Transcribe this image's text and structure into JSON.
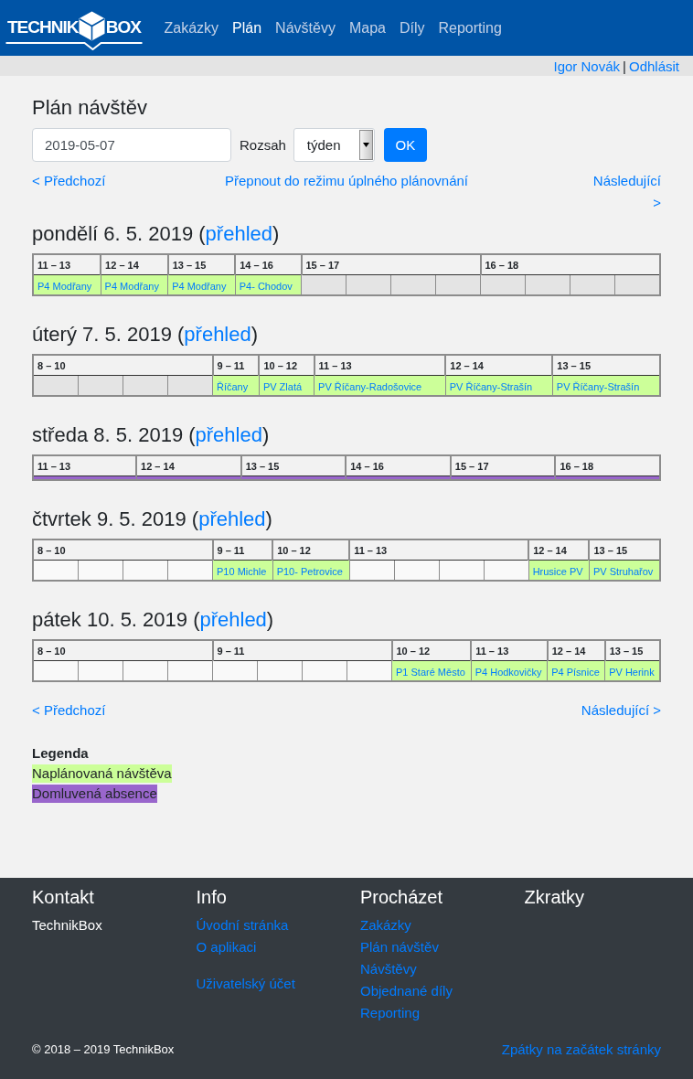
{
  "header": {
    "logo": {
      "left": "TECHNIK",
      "right": "BOX"
    },
    "nav": [
      {
        "label": "Zakázky",
        "selected": false
      },
      {
        "label": "Plán",
        "selected": true
      },
      {
        "label": "Návštěvy",
        "selected": false
      },
      {
        "label": "Mapa",
        "selected": false
      },
      {
        "label": "Díly",
        "selected": false
      },
      {
        "label": "Reporting",
        "selected": false
      }
    ]
  },
  "user_bar": {
    "user": "Igor Novák",
    "separator": "|",
    "logout": "Odhlásit"
  },
  "page_title": "Plán návštěv",
  "form": {
    "date": "2019-05-07",
    "range_label": "Rozsah",
    "range": "týden",
    "submit": "OK"
  },
  "pager_top": {
    "previous": "< Předchozí",
    "switch_mode": "Přepnout do režimu úplného plánovnání",
    "next": "Následující >"
  },
  "days": [
    {
      "heading": "pondělí 6. 5. 2019",
      "open": "(",
      "link": "přehled",
      "close": ")",
      "slots": [
        {
          "time": "11 – 13",
          "kind": "visit",
          "label": "P4 Modřany"
        },
        {
          "time": "12 – 14",
          "kind": "visit",
          "label": "P4 Modřany"
        },
        {
          "time": "13 – 15",
          "kind": "visit",
          "label": "P4 Modřany"
        },
        {
          "time": "14 – 16",
          "kind": "visit",
          "label": "P4- Chodov"
        },
        {
          "time": "15 – 17",
          "kind": "free",
          "disabled": true
        },
        {
          "time": "16 – 18",
          "kind": "free",
          "disabled": true
        }
      ]
    },
    {
      "heading": "úterý 7. 5. 2019",
      "open": "(",
      "link": "přehled",
      "close": ")",
      "slots": [
        {
          "time": "8 – 10",
          "kind": "free",
          "disabled": true
        },
        {
          "time": "9 – 11",
          "kind": "visit",
          "label": "Říčany"
        },
        {
          "time": "10 – 12",
          "kind": "visit",
          "label": "PV Zlatá"
        },
        {
          "time": "11 – 13",
          "kind": "visit",
          "label": "PV Říčany-Radošovice"
        },
        {
          "time": "12 – 14",
          "kind": "visit",
          "label": "PV Říčany-Strašín"
        },
        {
          "time": "13 – 15",
          "kind": "visit",
          "label": "PV Říčany-Strašín"
        }
      ]
    },
    {
      "heading": "středa 8. 5. 2019",
      "open": "(",
      "link": "přehled",
      "close": ")",
      "slots": [
        {
          "time": "11 – 13",
          "kind": "absence"
        },
        {
          "time": "12 – 14",
          "kind": "absence"
        },
        {
          "time": "13 – 15",
          "kind": "absence"
        },
        {
          "time": "14 – 16",
          "kind": "absence"
        },
        {
          "time": "15 – 17",
          "kind": "absence"
        },
        {
          "time": "16 – 18",
          "kind": "absence"
        }
      ]
    },
    {
      "heading": "čtvrtek 9. 5. 2019",
      "open": "(",
      "link": "přehled",
      "close": ")",
      "slots": [
        {
          "time": "8 – 10",
          "kind": "free",
          "disabled": false
        },
        {
          "time": "9 – 11",
          "kind": "visit",
          "label": "P10 Michle"
        },
        {
          "time": "10 – 12",
          "kind": "visit",
          "label": "P10- Petrovice"
        },
        {
          "time": "11 – 13",
          "kind": "free",
          "disabled": false
        },
        {
          "time": "12 – 14",
          "kind": "visit",
          "label": "Hrusice PV"
        },
        {
          "time": "13 – 15",
          "kind": "visit",
          "label": "PV Struhařov"
        }
      ]
    },
    {
      "heading": "pátek 10. 5. 2019",
      "open": "(",
      "link": "přehled",
      "close": ")",
      "slots": [
        {
          "time": "8 – 10",
          "kind": "free",
          "disabled": false
        },
        {
          "time": "9 – 11",
          "kind": "free",
          "disabled": false
        },
        {
          "time": "10 – 12",
          "kind": "visit",
          "label": "P1 Staré Město"
        },
        {
          "time": "11 – 13",
          "kind": "visit",
          "label": "P4 Hodkovičky"
        },
        {
          "time": "12 – 14",
          "kind": "visit",
          "label": "P4 Písnice"
        },
        {
          "time": "13 – 15",
          "kind": "visit",
          "label": "PV Herink"
        }
      ]
    }
  ],
  "pager_bottom": {
    "previous": "< Předchozí",
    "next": "Následující >"
  },
  "legend": {
    "title": "Legenda",
    "items": [
      {
        "label": "Naplánovaná návštěva",
        "color": "#ccff99"
      },
      {
        "label": "Domluvená absence",
        "color": "#9966cc"
      }
    ]
  },
  "footer": {
    "columns": [
      {
        "heading": "Kontakt",
        "kind": "text",
        "groups": [
          [
            "TechnikBox"
          ]
        ]
      },
      {
        "heading": "Info",
        "kind": "links",
        "groups": [
          [
            "Úvodní stránka",
            "O aplikaci"
          ],
          [
            "Uživatelský účet"
          ]
        ]
      },
      {
        "heading": "Procházet",
        "kind": "links",
        "groups": [
          [
            "Zakázky",
            "Plán návštěv",
            "Návštěvy",
            "Objednané díly",
            "Reporting"
          ]
        ]
      },
      {
        "heading": "Zkratky"
      }
    ],
    "copyright": "© 2018 – 2019 TechnikBox",
    "back_to_top": "Zpátky na začátek stránky"
  }
}
